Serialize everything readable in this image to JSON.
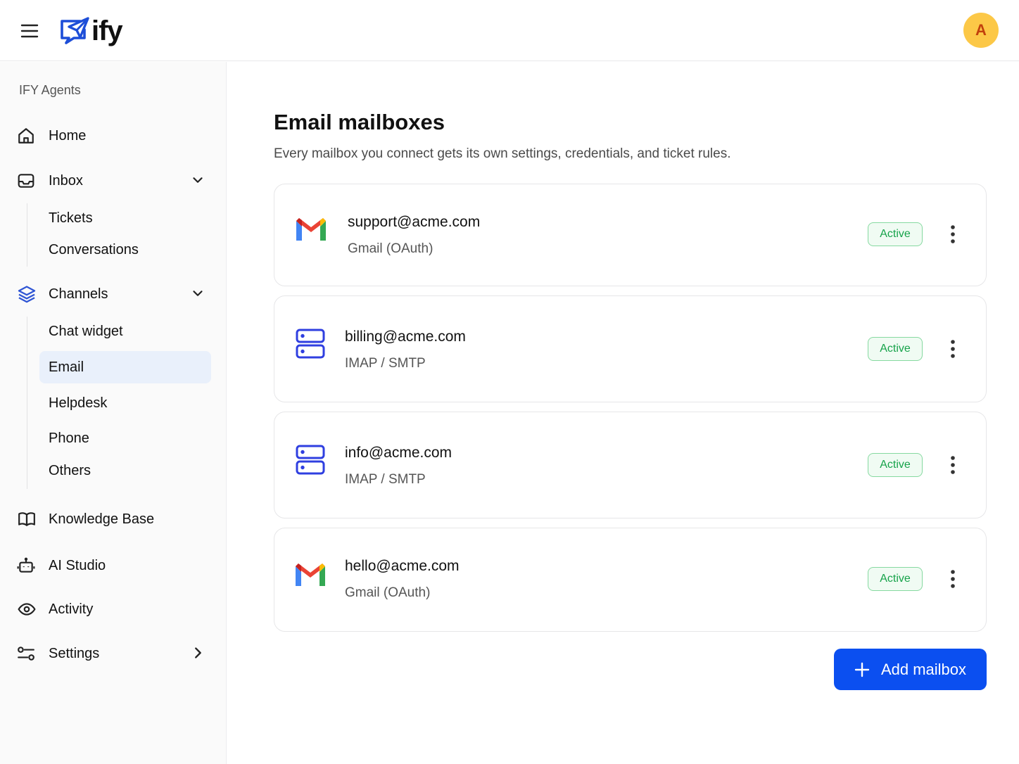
{
  "brand": {
    "logo_text": "ify",
    "logo_color": "#1d4ed8"
  },
  "user": {
    "avatar_initial": "A",
    "avatar_color": "#fcc847"
  },
  "sidebar": {
    "section_label": "IFY Agents",
    "items": {
      "home": {
        "label": "Home",
        "icon": "home-icon"
      },
      "inbox": {
        "label": "Inbox",
        "icon": "inbox-icon",
        "expanded": true
      },
      "tickets": {
        "label": "Tickets"
      },
      "conversations": {
        "label": "Conversations"
      },
      "channels": {
        "label": "Channels",
        "icon": "layers-icon",
        "expanded": true
      },
      "chat_widget": {
        "label": "Chat widget"
      },
      "email": {
        "label": "Email",
        "active": true
      },
      "helpdesk": {
        "label": "Helpdesk"
      },
      "phone": {
        "label": "Phone"
      },
      "others": {
        "label": "Others"
      },
      "knowledge_base": {
        "label": "Knowledge Base",
        "icon": "book-icon"
      },
      "ai_studio": {
        "label": "AI Studio",
        "icon": "robot-icon"
      },
      "activity": {
        "label": "Activity",
        "icon": "eye-icon"
      },
      "settings": {
        "label": "Settings",
        "icon": "sliders-icon"
      }
    }
  },
  "main": {
    "title": "Email mailboxes",
    "subtitle": "Every mailbox you connect gets its own settings, credentials, and ticket rules.",
    "mailboxes": [
      {
        "email": "support@acme.com",
        "type": "Gmail (OAuth)",
        "status": "Active",
        "icon": "gmail-icon"
      },
      {
        "email": "billing@acme.com",
        "type": "IMAP / SMTP",
        "status": "Active",
        "icon": "server-icon"
      },
      {
        "email": "info@acme.com",
        "type": "IMAP / SMTP",
        "status": "Active",
        "icon": "server-icon"
      },
      {
        "email": "hello@acme.com",
        "type": "Gmail (OAuth)",
        "status": "Active",
        "icon": "gmail-icon"
      }
    ],
    "add_button_label": "Add mailbox"
  },
  "colors": {
    "accent": "#0b4ff0",
    "active_bg": "#e9f0fb",
    "status_green": "#16a34a"
  }
}
